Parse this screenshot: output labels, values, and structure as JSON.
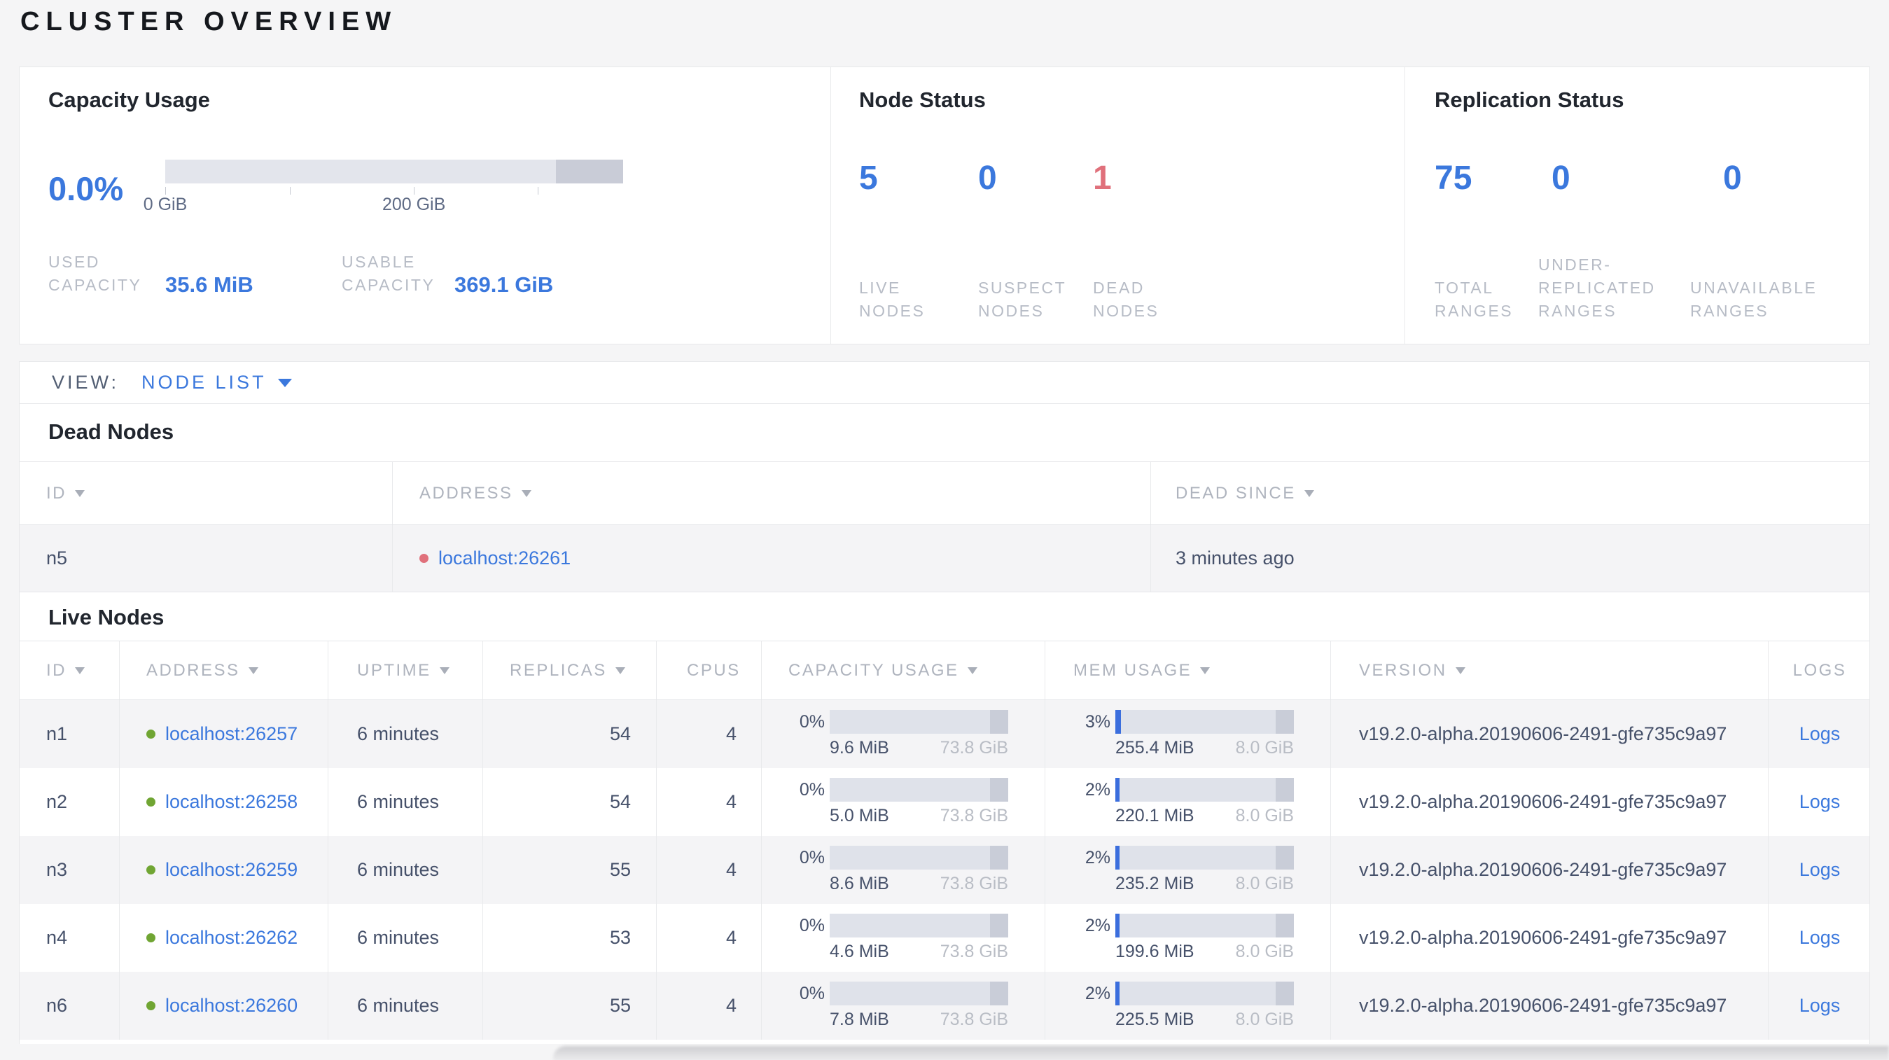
{
  "page": {
    "title": "CLUSTER OVERVIEW"
  },
  "colors": {
    "accent_blue": "#3b78dd",
    "alert_red": "#e0707b",
    "live_green": "#70a533"
  },
  "capacity_panel": {
    "title": "Capacity Usage",
    "percent": "0.0%",
    "bar": {
      "used_pct": 0,
      "reserved_pct": 14.7
    },
    "ticks": [
      {
        "label": "0 GiB",
        "pos_pct": 0
      },
      {
        "label": "",
        "pos_pct": 27.15
      },
      {
        "label": "200 GiB",
        "pos_pct": 54.3
      },
      {
        "label": "",
        "pos_pct": 81.4
      }
    ],
    "used_label": "USED CAPACITY",
    "used_value": "35.6 MiB",
    "usable_label": "USABLE CAPACITY",
    "usable_value": "369.1 GiB"
  },
  "node_status_panel": {
    "title": "Node Status",
    "metrics": [
      {
        "value": "5",
        "label": "LIVE NODES",
        "color": "blue"
      },
      {
        "value": "0",
        "label": "SUSPECT NODES",
        "color": "blue"
      },
      {
        "value": "1",
        "label": "DEAD NODES",
        "color": "red"
      }
    ]
  },
  "replication_panel": {
    "title": "Replication Status",
    "metrics": [
      {
        "value": "75",
        "label": "TOTAL RANGES",
        "color": "blue"
      },
      {
        "value": "0",
        "label": "UNDER-REPLICATED RANGES",
        "color": "blue"
      },
      {
        "value": "0",
        "label": "UNAVAILABLE RANGES",
        "color": "blue"
      }
    ]
  },
  "view_bar": {
    "label": "VIEW:",
    "selected": "NODE LIST"
  },
  "dead_nodes": {
    "title": "Dead Nodes",
    "columns": [
      {
        "label": "ID",
        "sortable": true
      },
      {
        "label": "ADDRESS",
        "sortable": true
      },
      {
        "label": "DEAD SINCE",
        "sortable": true
      }
    ],
    "rows": [
      {
        "id": "n5",
        "address": "localhost:26261",
        "dead_since": "3 minutes ago"
      }
    ]
  },
  "live_nodes": {
    "title": "Live Nodes",
    "columns": [
      {
        "label": "ID",
        "sortable": true
      },
      {
        "label": "ADDRESS",
        "sortable": true
      },
      {
        "label": "UPTIME",
        "sortable": true
      },
      {
        "label": "REPLICAS",
        "sortable": true
      },
      {
        "label": "CPUS",
        "sortable": false
      },
      {
        "label": "CAPACITY USAGE",
        "sortable": true
      },
      {
        "label": "MEM USAGE",
        "sortable": true
      },
      {
        "label": "VERSION",
        "sortable": true
      },
      {
        "label": "LOGS",
        "sortable": false
      }
    ],
    "rows": [
      {
        "id": "n1",
        "address": "localhost:26257",
        "uptime": "6 minutes",
        "replicas": "54",
        "cpus": "4",
        "capacity": {
          "pct": "0%",
          "used": "9.6 MiB",
          "total": "73.8 GiB",
          "used_frac": 0,
          "reserved_frac": 0.102
        },
        "mem": {
          "pct": "3%",
          "used": "255.4 MiB",
          "total": "8.0 GiB",
          "used_frac": 0.03,
          "reserved_frac": 0.102
        },
        "version": "v19.2.0-alpha.20190606-2491-gfe735c9a97",
        "logs_label": "Logs"
      },
      {
        "id": "n2",
        "address": "localhost:26258",
        "uptime": "6 minutes",
        "replicas": "54",
        "cpus": "4",
        "capacity": {
          "pct": "0%",
          "used": "5.0 MiB",
          "total": "73.8 GiB",
          "used_frac": 0,
          "reserved_frac": 0.102
        },
        "mem": {
          "pct": "2%",
          "used": "220.1 MiB",
          "total": "8.0 GiB",
          "used_frac": 0.02,
          "reserved_frac": 0.102
        },
        "version": "v19.2.0-alpha.20190606-2491-gfe735c9a97",
        "logs_label": "Logs"
      },
      {
        "id": "n3",
        "address": "localhost:26259",
        "uptime": "6 minutes",
        "replicas": "55",
        "cpus": "4",
        "capacity": {
          "pct": "0%",
          "used": "8.6 MiB",
          "total": "73.8 GiB",
          "used_frac": 0,
          "reserved_frac": 0.102
        },
        "mem": {
          "pct": "2%",
          "used": "235.2 MiB",
          "total": "8.0 GiB",
          "used_frac": 0.02,
          "reserved_frac": 0.102
        },
        "version": "v19.2.0-alpha.20190606-2491-gfe735c9a97",
        "logs_label": "Logs"
      },
      {
        "id": "n4",
        "address": "localhost:26262",
        "uptime": "6 minutes",
        "replicas": "53",
        "cpus": "4",
        "capacity": {
          "pct": "0%",
          "used": "4.6 MiB",
          "total": "73.8 GiB",
          "used_frac": 0,
          "reserved_frac": 0.102
        },
        "mem": {
          "pct": "2%",
          "used": "199.6 MiB",
          "total": "8.0 GiB",
          "used_frac": 0.02,
          "reserved_frac": 0.102
        },
        "version": "v19.2.0-alpha.20190606-2491-gfe735c9a97",
        "logs_label": "Logs"
      },
      {
        "id": "n6",
        "address": "localhost:26260",
        "uptime": "6 minutes",
        "replicas": "55",
        "cpus": "4",
        "capacity": {
          "pct": "0%",
          "used": "7.8 MiB",
          "total": "73.8 GiB",
          "used_frac": 0,
          "reserved_frac": 0.102
        },
        "mem": {
          "pct": "2%",
          "used": "225.5 MiB",
          "total": "8.0 GiB",
          "used_frac": 0.02,
          "reserved_frac": 0.102
        },
        "version": "v19.2.0-alpha.20190606-2491-gfe735c9a97",
        "logs_label": "Logs"
      }
    ]
  }
}
